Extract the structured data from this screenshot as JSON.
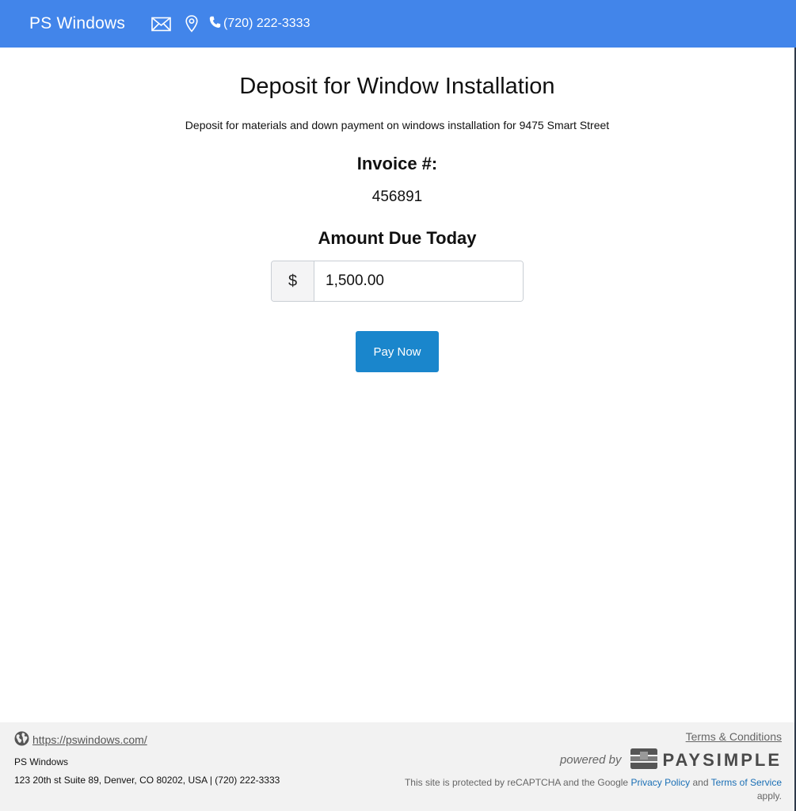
{
  "header": {
    "brand": "PS Windows",
    "phone": "(720) 222-3333",
    "icons": [
      "mail-icon",
      "location-pin-icon",
      "phone-icon"
    ],
    "bg_color": "#4285ea"
  },
  "main": {
    "title": "Deposit for Window Installation",
    "description": "Deposit for materials and down payment on windows installation for 9475 Smart Street",
    "invoice_label": "Invoice #:",
    "invoice_number": "456891",
    "amount_label": "Amount Due Today",
    "currency_symbol": "$",
    "amount_value": "1,500.00",
    "pay_button": "Pay Now",
    "pay_button_color": "#1a86cc"
  },
  "footer": {
    "url": "https://pswindows.com/",
    "business_name": "PS Windows",
    "address": "123 20th st Suite 89, Denver, CO 80202, USA | (720) 222-3333",
    "terms": "Terms & Conditions",
    "powered_by": "powered by",
    "provider": "PAYSIMPLE",
    "recaptcha_prefix": "This site is protected by reCAPTCHA and the Google",
    "privacy_link": "Privacy Policy",
    "and_text": "and",
    "tos_link": "Terms of Service",
    "apply_text": "apply."
  }
}
